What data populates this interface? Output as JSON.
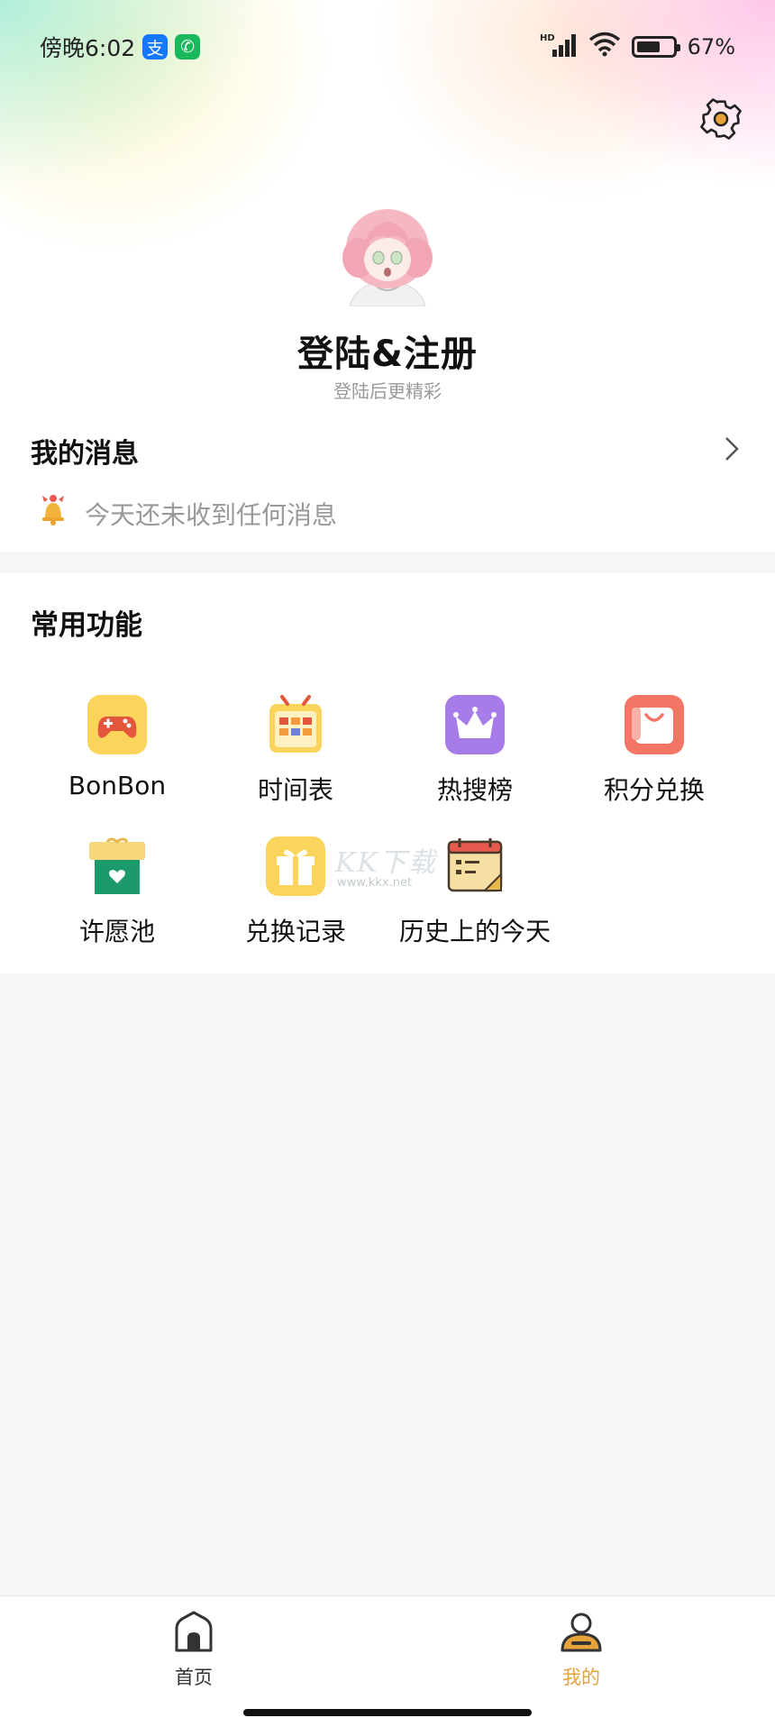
{
  "status_bar": {
    "time": "傍晚6:02",
    "alipay_glyph": "支",
    "phone_glyph": "✆",
    "network": "HD",
    "battery_percent": "67%",
    "battery_level": 0.67
  },
  "profile": {
    "title": "登陆&注册",
    "subtitle": "登陆后更精彩",
    "avatar_icon": "anime-girl-avatar",
    "settings_icon": "gear-icon"
  },
  "messages": {
    "title": "我的消息",
    "empty_text": "今天还未收到任何消息"
  },
  "functions": {
    "title": "常用功能",
    "items": [
      {
        "label": "BonBon",
        "icon": "gamepad-icon"
      },
      {
        "label": "时间表",
        "icon": "calendar-icon"
      },
      {
        "label": "热搜榜",
        "icon": "crown-icon"
      },
      {
        "label": "积分兑换",
        "icon": "shopping-bag-icon"
      },
      {
        "label": "许愿池",
        "icon": "wish-box-icon"
      },
      {
        "label": "兑换记录",
        "icon": "gift-icon"
      },
      {
        "label": "历史上的今天",
        "icon": "history-calendar-icon"
      }
    ]
  },
  "watermark": {
    "text": "KK下载",
    "url": "www.kkx.net"
  },
  "bottom_nav": {
    "items": [
      {
        "label": "首页",
        "icon": "home-icon",
        "active": false
      },
      {
        "label": "我的",
        "icon": "profile-icon",
        "active": true
      }
    ],
    "active_color": "#e8a33a"
  },
  "colors": {
    "accent": "#e8a33a",
    "subtle_text": "#999999"
  }
}
